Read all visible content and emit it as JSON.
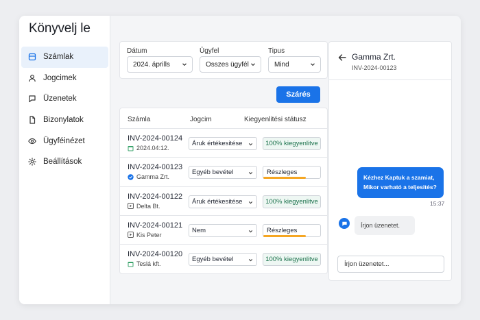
{
  "app": {
    "brand": "Könyvelj le"
  },
  "colors": {
    "accent": "#1a73e8",
    "success": "#19704a",
    "partial": "#f5a623"
  },
  "sidebar": {
    "items": [
      {
        "label": "Számlak",
        "icon": "invoice-icon",
        "active": true
      },
      {
        "label": "Jogcimek",
        "icon": "user-icon",
        "active": false
      },
      {
        "label": "Üzenetek",
        "icon": "message-icon",
        "active": false
      },
      {
        "label": "Bizonylatok",
        "icon": "document-icon",
        "active": false
      },
      {
        "label": "Ügyféinézet",
        "icon": "eye-icon",
        "active": false
      },
      {
        "label": "Beállítások",
        "icon": "gear-icon",
        "active": false
      }
    ]
  },
  "filters": {
    "date_label": "Dátum",
    "date_value": "2024. áprills",
    "client_label": "Ügyfel",
    "client_value": "Osszes ügyfél",
    "type_label": "Tipus",
    "type_value": "Mind",
    "apply_label": "Szárés"
  },
  "table": {
    "headers": [
      "Számla",
      "Jogcim",
      "Kiegyenlitési státusz"
    ],
    "rows": [
      {
        "invoice": "INV-2024-00124",
        "sub": "2024.04:12.",
        "sub_icon": "calendar-icon",
        "category": "Áruk értékesitése",
        "status": "100% kiegyenlitve",
        "status_kind": "full",
        "progress": 1.0
      },
      {
        "invoice": "INV-2024-00123",
        "sub": "Gamma Zrt.",
        "sub_icon": "check-badge-icon",
        "category": "Egyéb bevétel",
        "status": "Részleges",
        "status_kind": "partial",
        "progress": 0.75
      },
      {
        "invoice": "INV-2024-00122",
        "sub": "Delta Bt.",
        "sub_icon": "play-box-icon",
        "category": "Áruk értékesitése",
        "status": "100% kiegyenlitve",
        "status_kind": "full",
        "progress": 1.0
      },
      {
        "invoice": "INV-2024-00121",
        "sub": "Kis Peter",
        "sub_icon": "play-box-icon",
        "category": "Nem",
        "status": "Részleges",
        "status_kind": "partial",
        "progress": 0.75
      },
      {
        "invoice": "INV-2024-00120",
        "sub": "Teslá kft.",
        "sub_icon": "calendar-green-icon",
        "category": "Egyéb bevétel",
        "status": "100% kiegyenlitve",
        "status_kind": "full",
        "progress": 1.0
      }
    ]
  },
  "panel": {
    "title": "Gamma Zrt.",
    "subtitle": "INV-2024-00123",
    "outgoing_message_line1": "Kézhez Kaptuk a szamiat,",
    "outgoing_message_line2": "Mikor varható a teljesités?",
    "time": "15:37",
    "incoming_message": "Írjon üzenetet.",
    "input_placeholder": "Írjon üzenetet..."
  }
}
